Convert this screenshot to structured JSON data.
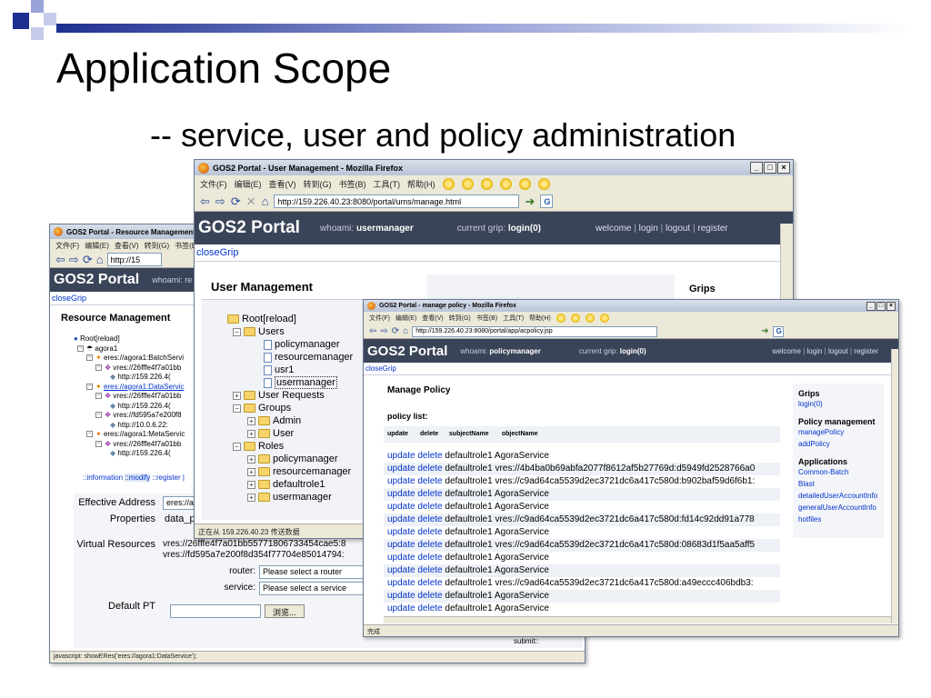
{
  "slide": {
    "title": "Application Scope",
    "subtitle": "-- service, user and policy administration"
  },
  "colors": {
    "deco_blue": "#1f2f8f",
    "deco_light": "#9aa4d8",
    "portal_header": "#3a4458",
    "link": "#0033cc"
  },
  "browser": {
    "menu": [
      "文件(F)",
      "编辑(E)",
      "查看(V)",
      "转到(G)",
      "书签(B)",
      "工具(T)",
      "帮助(H)"
    ],
    "close_glyph": "×",
    "min_glyph": "_",
    "max_glyph": "□"
  },
  "win_resource": {
    "title": "GOS2 Portal - Resource Management",
    "url": "http://15",
    "logo": "GOS2 Portal",
    "whoami": "whoami: re",
    "close_grip": "closeGrip",
    "heading": "Resource Management",
    "tree": {
      "root": "Root[reload]",
      "n1": "agora1",
      "n2": "eres://agora1:BatchServi",
      "n3": "vres://26fffe4f7a01bb",
      "n4": "http://159.226.4(",
      "n5": "eres://agora1:DataServic",
      "n6": "vres://26fffe4f7a01bb",
      "n7": "http://159.226.4(",
      "n8": "vres://fd595a7e200f8",
      "n9": "http://10.0.6.22:",
      "n10": "eres://agora1:MetaServic",
      "n11": "vres://26fffe4f7a01bb",
      "n12": "http://159.226.4("
    },
    "tabs": {
      "information": "::information",
      "modify": "::modify",
      "register": "::register |"
    },
    "form": {
      "effective_address_label": "Effective Address",
      "effective_address_value": "eres://a",
      "properties_label": "Properties",
      "properties_value": "data_p",
      "virtual_resources_label": "Virtual Resources",
      "vres1": "vres://26fffe4f7a01bb55771806733454cae5:8",
      "vres2": "vres://fd595a7e200f8d354f77704e85014794:",
      "router_label": "router:",
      "router_placeholder": "Please select a router",
      "service_label": "service:",
      "service_placeholder": "Please select a service",
      "default_pt_label": "Default PT",
      "browse_button": "浏览...",
      "submit": "submit::"
    },
    "status": "javascript: showERes('eres://agora1:DataService');"
  },
  "win_user": {
    "title": "GOS2 Portal - User Management - Mozilla Firefox",
    "url": "http://159.226.40.23:8080/portal/ums/manage.html",
    "search_prefix": "G",
    "logo": "GOS2 Portal",
    "whoami_label": "whoami:",
    "whoami_value": "usermanager",
    "grip_label": "current grip:",
    "grip_value": "login(0)",
    "welcome": "welcome",
    "login": "login",
    "logout": "logout",
    "register": "register",
    "close_grip": "closeGrip",
    "heading": "User Management",
    "grips": "Grips",
    "tree": {
      "root": "Root[reload]",
      "users": "Users",
      "u1": "policymanager",
      "u2": "resourcemanager",
      "u3": "usr1",
      "u4": "usermanager",
      "requests": "User Requests",
      "groups": "Groups",
      "g1": "Admin",
      "g2": "User",
      "roles": "Roles",
      "r1": "policymanager",
      "r2": "resourcemanager",
      "r3": "defaultrole1",
      "r4": "usermanager"
    },
    "status": "正在从 159.226.40.23 传送数据"
  },
  "win_policy": {
    "title": "GOS2 Portal - manage policy - Mozilla Firefox",
    "url": "http://159.226.40.23:8080/portal/app/acpolicy.jsp",
    "search_prefix": "G",
    "logo": "GOS2 Portal",
    "whoami_label": "whoami:",
    "whoami_value": "policymanager",
    "grip_label": "current grip:",
    "grip_value": "login(0)",
    "welcome": "welcome",
    "login": "login",
    "logout": "logout",
    "register": "register",
    "close_grip": "closeGrip",
    "heading": "Manage Policy",
    "list_title": "policy list:",
    "columns": {
      "update": "update",
      "delete": "delete",
      "subject": "subjectName",
      "object": "objectName"
    },
    "rows": [
      {
        "update": "update",
        "delete": "delete",
        "subject": "defaultrole1",
        "object": "AgoraService"
      },
      {
        "update": "update",
        "delete": "delete",
        "subject": "defaultrole1",
        "object": "vres://4b4ba0b69abfa2077f8612af5b27769d:d5949fd2528766a0"
      },
      {
        "update": "update",
        "delete": "delete",
        "subject": "defaultrole1",
        "object": "vres://c9ad64ca5539d2ec3721dc6a417c580d:b902baf59d6f6b1:"
      },
      {
        "update": "update",
        "delete": "delete",
        "subject": "defaultrole1",
        "object": "AgoraService"
      },
      {
        "update": "update",
        "delete": "delete",
        "subject": "defaultrole1",
        "object": "AgoraService"
      },
      {
        "update": "update",
        "delete": "delete",
        "subject": "defaultrole1",
        "object": "vres://c9ad64ca5539d2ec3721dc6a417c580d:fd14c92dd91a778"
      },
      {
        "update": "update",
        "delete": "delete",
        "subject": "defaultrole1",
        "object": "AgoraService"
      },
      {
        "update": "update",
        "delete": "delete",
        "subject": "defaultrole1",
        "object": "vres://c9ad64ca5539d2ec3721dc6a417c580d:08683d1f5aa5aff5"
      },
      {
        "update": "update",
        "delete": "delete",
        "subject": "defaultrole1",
        "object": "AgoraService"
      },
      {
        "update": "update",
        "delete": "delete",
        "subject": "defaultrole1",
        "object": "AgoraService"
      },
      {
        "update": "update",
        "delete": "delete",
        "subject": "defaultrole1",
        "object": "vres://c9ad64ca5539d2ec3721dc6a417c580d:a49eccc406bdb3:"
      },
      {
        "update": "update",
        "delete": "delete",
        "subject": "defaultrole1",
        "object": "AgoraService"
      },
      {
        "update": "update",
        "delete": "delete",
        "subject": "defaultrole1",
        "object": "AgoraService"
      }
    ],
    "side": {
      "grips": "Grips",
      "login": "login(0)",
      "pm_head": "Policy management",
      "manage_policy": "managePolicy",
      "add_policy": "addPolicy",
      "apps_head": "Applications",
      "a1": "Common-Batch",
      "a2": "Blast",
      "a3": "detailedUserAccountInfo",
      "a4": "generalUserAccountInfo",
      "a5": "hotfiles"
    },
    "status": "完成"
  }
}
